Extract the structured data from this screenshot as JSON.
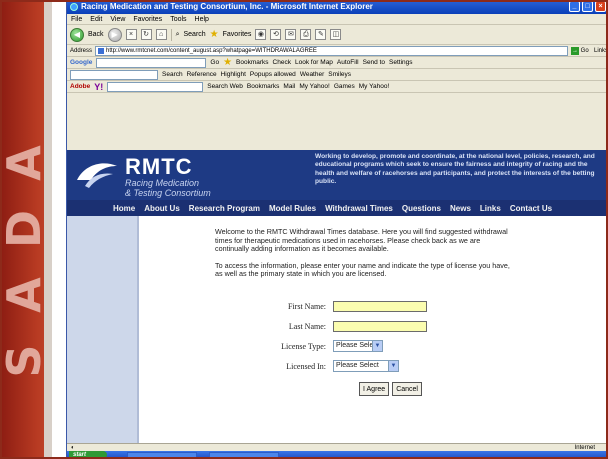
{
  "slide": {
    "band_letters": [
      "A",
      "D",
      "A",
      "S"
    ],
    "band_color": "#b73a22"
  },
  "browser": {
    "title": "Racing Medication and Testing Consortium, Inc. - Microsoft Internet Explorer",
    "menu": [
      "File",
      "Edit",
      "View",
      "Favorites",
      "Tools",
      "Help"
    ],
    "toolbar": {
      "back": "Back",
      "search": "Search",
      "favorites": "Favorites"
    },
    "address_label": "Address",
    "address": "http://www.rmtcnet.com/content_august.asp?whatpage=WITHDRAWALAGREE",
    "go": "Go",
    "links": "Links",
    "google_toolbar": {
      "label": "Google",
      "go": "Go",
      "bookmarks": "Bookmarks",
      "check": "Check",
      "lookfor": "Look for Map",
      "autofill": "AutoFill",
      "sendto": "Send to",
      "settings": "Settings"
    },
    "search_toolbar": {
      "search": "Search",
      "reference": "Reference",
      "highlight": "Highlight",
      "popups": "Popups allowed",
      "weather": "Weather",
      "smileys": "Smileys"
    },
    "yahoo_toolbar": {
      "adobe": "Adobe",
      "search_web": "Search Web",
      "bookmarks": "Bookmarks",
      "mail": "Mail",
      "my_yahoo": "My Yahoo!",
      "games": "Games",
      "my_yahoo2": "My Yahoo!"
    },
    "status": {
      "zone": "Internet"
    },
    "taskbar": {
      "start": "start"
    }
  },
  "site": {
    "logo": "RMTC",
    "logo_sub1": "Racing Medication",
    "logo_sub2": "& Testing Consortium",
    "mission": "Working to develop, promote and coordinate, at the national level, policies, research, and educational programs which seek to ensure the fairness and integrity of racing and the health and welfare of racehorses and participants, and protect the interests of the betting public.",
    "nav": [
      "Home",
      "About Us",
      "Research Program",
      "Model Rules",
      "Withdrawal Times",
      "Questions",
      "News",
      "Links",
      "Contact Us"
    ],
    "intro": "Welcome to the RMTC Withdrawal Times database. Here you will find suggested withdrawal times for therapeutic medications used in racehorses. Please check back as we are continually adding information as it becomes available.",
    "instructions": "To access the information, please enter your name and indicate the type of license you have, as well as the primary state in which you are licensed.",
    "form": {
      "first_name_label": "First Name:",
      "last_name_label": "Last Name:",
      "license_type_label": "License Type:",
      "license_type_value": "Please Select",
      "licensed_in_label": "Licensed In:",
      "licensed_in_value": "Please Select",
      "agree_button": "I Agree",
      "cancel_button": "Cancel"
    }
  }
}
